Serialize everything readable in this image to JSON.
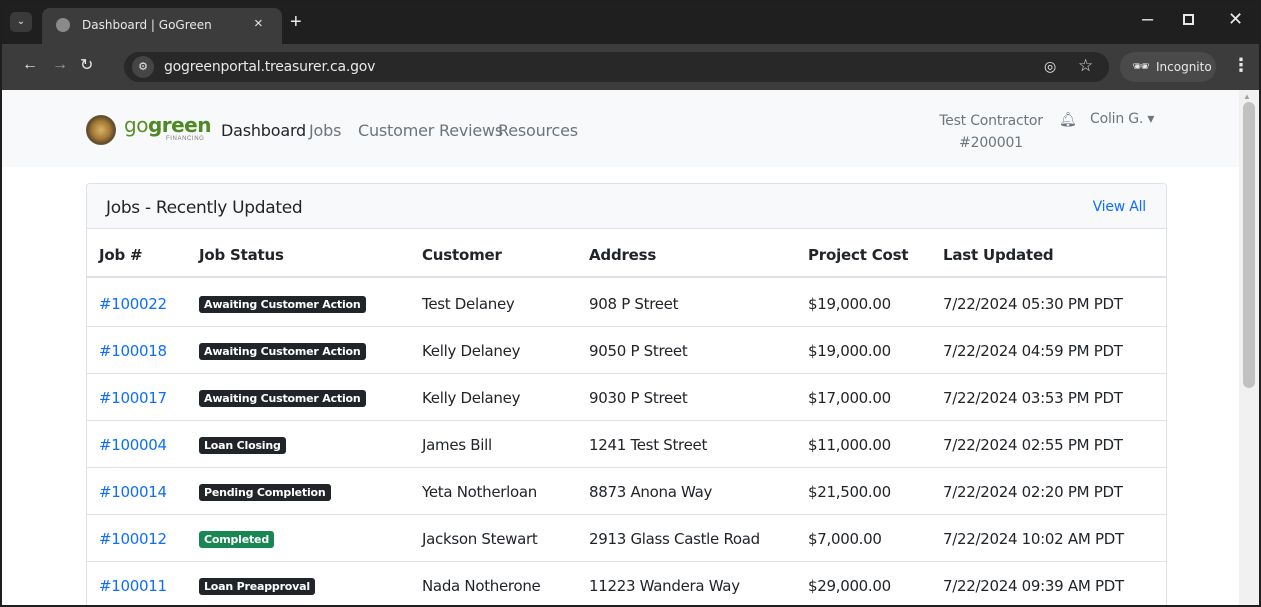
{
  "browser": {
    "tab_title": "Dashboard | GoGreen",
    "tab_close": "×",
    "new_tab": "+",
    "url": "gogreenportal.treasurer.ca.gov",
    "incognito_label": "Incognito"
  },
  "brand": {
    "go": "go",
    "green": "green",
    "tagline": "FINANCING"
  },
  "nav": {
    "links": [
      "Dashboard",
      "Jobs",
      "Customer Reviews",
      "Resources"
    ],
    "active": "Dashboard",
    "contractor_name": "Test Contractor",
    "contractor_id": "#200001",
    "user": "Colin G. ▾"
  },
  "card": {
    "title": "Jobs - Recently Updated",
    "view_all": "View All",
    "columns": [
      "Job #",
      "Job Status",
      "Customer",
      "Address",
      "Project Cost",
      "Last Updated"
    ],
    "rows": [
      {
        "job": "#100022",
        "status": "Awaiting Customer Action",
        "status_color": "#212529",
        "customer": "Test Delaney",
        "address": "908 P Street",
        "cost": "$19,000.00",
        "updated": "7/22/2024 05:30 PM PDT"
      },
      {
        "job": "#100018",
        "status": "Awaiting Customer Action",
        "status_color": "#212529",
        "customer": "Kelly Delaney",
        "address": "9050 P Street",
        "cost": "$19,000.00",
        "updated": "7/22/2024 04:59 PM PDT"
      },
      {
        "job": "#100017",
        "status": "Awaiting Customer Action",
        "status_color": "#212529",
        "customer": "Kelly Delaney",
        "address": "9030 P Street",
        "cost": "$17,000.00",
        "updated": "7/22/2024 03:53 PM PDT"
      },
      {
        "job": "#100004",
        "status": "Loan Closing",
        "status_color": "#212529",
        "customer": "James Bill",
        "address": "1241 Test Street",
        "cost": "$11,000.00",
        "updated": "7/22/2024 02:55 PM PDT"
      },
      {
        "job": "#100014",
        "status": "Pending Completion",
        "status_color": "#212529",
        "customer": "Yeta Notherloan",
        "address": "8873 Anona Way",
        "cost": "$21,500.00",
        "updated": "7/22/2024 02:20 PM PDT"
      },
      {
        "job": "#100012",
        "status": "Completed",
        "status_color": "#198754",
        "customer": "Jackson Stewart",
        "address": "2913 Glass Castle Road",
        "cost": "$7,000.00",
        "updated": "7/22/2024 10:02 AM PDT"
      },
      {
        "job": "#100011",
        "status": "Loan Preapproval",
        "status_color": "#212529",
        "customer": "Nada Notherone",
        "address": "11223 Wandera Way",
        "cost": "$29,000.00",
        "updated": "7/22/2024 09:39 AM PDT"
      }
    ]
  },
  "colors": {
    "link": "#0d6efd",
    "badge_dark": "#212529",
    "badge_success": "#198754",
    "brand_green": "#4d8a21"
  }
}
